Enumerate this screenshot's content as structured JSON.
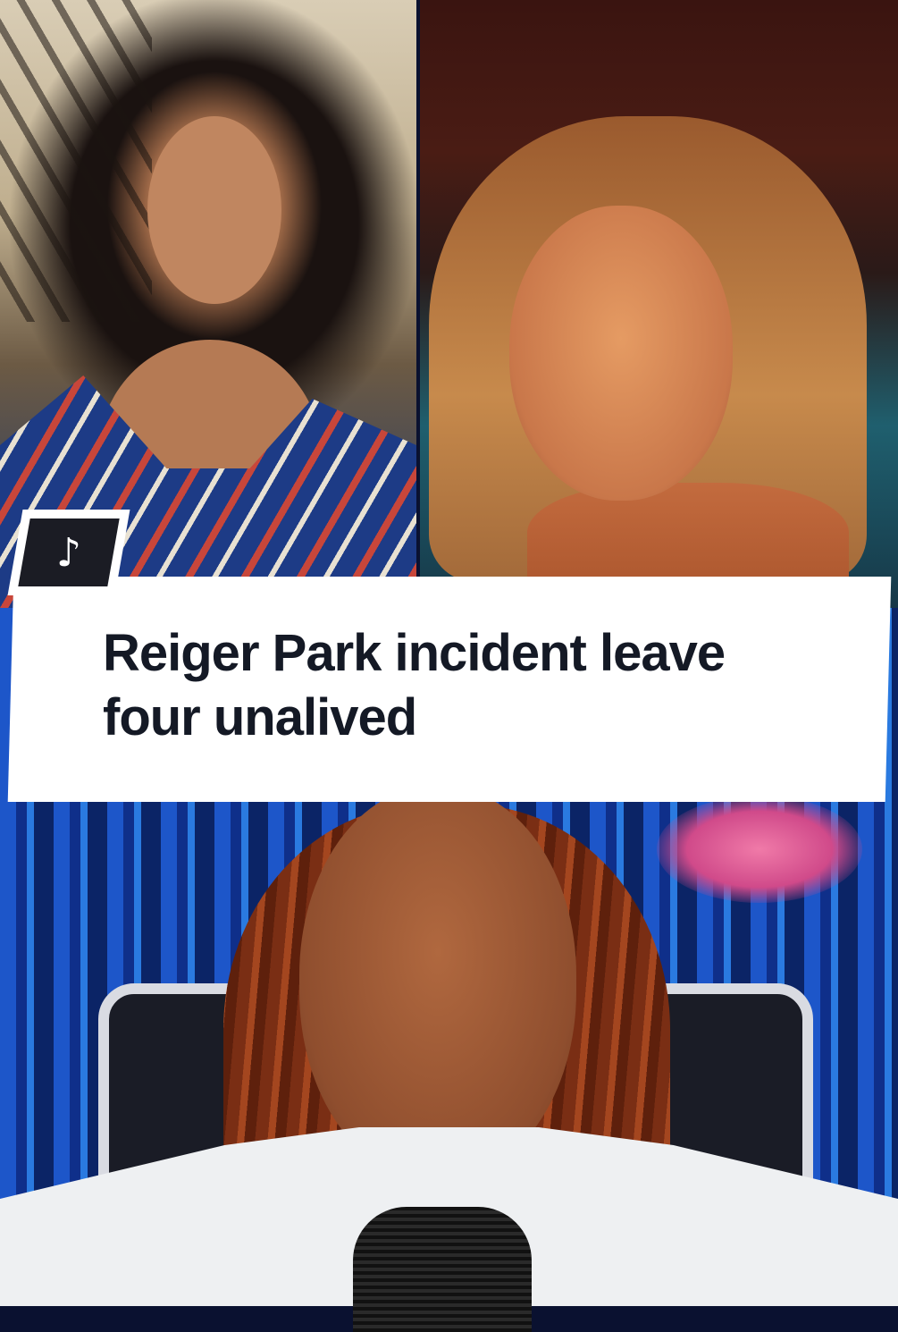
{
  "caption": {
    "line1": "Reiger Park incident leave",
    "line2": "four unalived"
  },
  "logo": {
    "icon": "tiktok-icon",
    "glyph": "♪",
    "badge_color": "#1b1c24"
  },
  "colors": {
    "caption_bg": "#ffffff",
    "caption_text": "#141925"
  }
}
